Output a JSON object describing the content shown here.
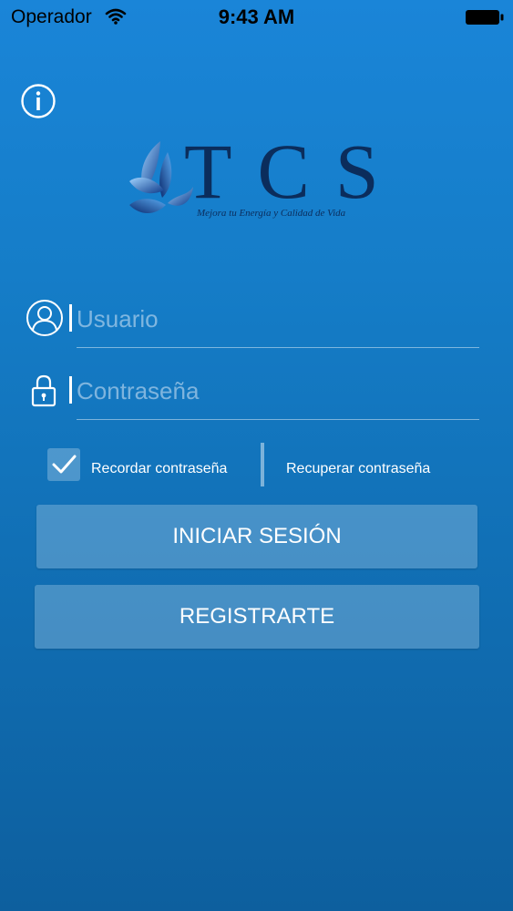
{
  "status_bar": {
    "carrier": "Operador",
    "time": "9:43 AM",
    "wifi_icon": "wifi-icon",
    "battery_icon": "battery-full-icon"
  },
  "info_icon": "info-circle-icon",
  "logo": {
    "letters": "TCS",
    "tagline": "Mejora tu Energía y Calidad de Vida",
    "brand_color": "#0b2d5c",
    "emblem": "blue-butterfly-leaf-emblem"
  },
  "login_form": {
    "username_placeholder": "Usuario",
    "username_value": "",
    "username_icon": "user-circle-icon",
    "password_placeholder": "Contraseña",
    "password_value": "",
    "password_icon": "lock-icon",
    "remember_label": "Recordar contraseña",
    "remember_checked": true,
    "recover_label": "Recuperar contraseña"
  },
  "buttons": {
    "login": "INICIAR SESIÓN",
    "register": "REGISTRARTE"
  },
  "colors": {
    "background_top": "#1a85d8",
    "background_bottom": "#0d5f9e",
    "button_fill": "rgba(152,194,226,0.40)"
  }
}
